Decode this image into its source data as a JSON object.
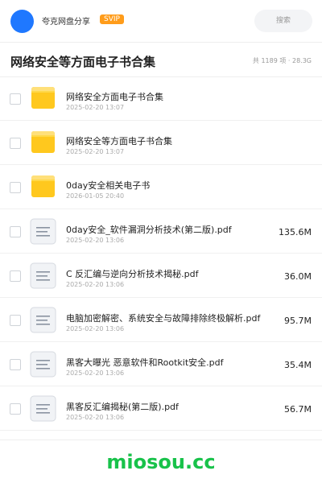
{
  "topbar": {
    "username": "夸克网盘分享",
    "badge": "SVIP",
    "search_placeholder": "搜索"
  },
  "header": {
    "title": "网络安全等方面电子书合集",
    "meta": "共 1189 项 · 28.3G"
  },
  "files": [
    {
      "type": "folder",
      "name": "网络安全方面电子书合集",
      "time": "2025-02-20 13:07",
      "size": ""
    },
    {
      "type": "folder",
      "name": "网络安全等方面电子书合集",
      "time": "2025-02-20 13:07",
      "size": ""
    },
    {
      "type": "folder",
      "name": "0day安全相关电子书",
      "time": "2026-01-05 20:40",
      "size": ""
    },
    {
      "type": "file",
      "name": "0day安全_软件漏洞分析技术(第二版).pdf",
      "time": "2025-02-20 13:06",
      "size": "135.6M"
    },
    {
      "type": "file",
      "name": "C 反汇编与逆向分析技术揭秘.pdf",
      "time": "2025-02-20 13:06",
      "size": "36.0M"
    },
    {
      "type": "file",
      "name": "电脑加密解密、系统安全与故障排除终极解析.pdf",
      "time": "2025-02-20 13:06",
      "size": "95.7M"
    },
    {
      "type": "file",
      "name": "黑客大曝光 恶意软件和Rootkit安全.pdf",
      "time": "2025-02-20 13:06",
      "size": "35.4M"
    },
    {
      "type": "file",
      "name": "黑客反汇编揭秘(第二版).pdf",
      "time": "2025-02-20 13:06",
      "size": "56.7M"
    }
  ],
  "watermark": "miosou.cc",
  "colors": {
    "accent": "#1f78ff",
    "badge": "#ff9c1a",
    "folder": "#ffc81e",
    "watermark": "#18c24a"
  }
}
